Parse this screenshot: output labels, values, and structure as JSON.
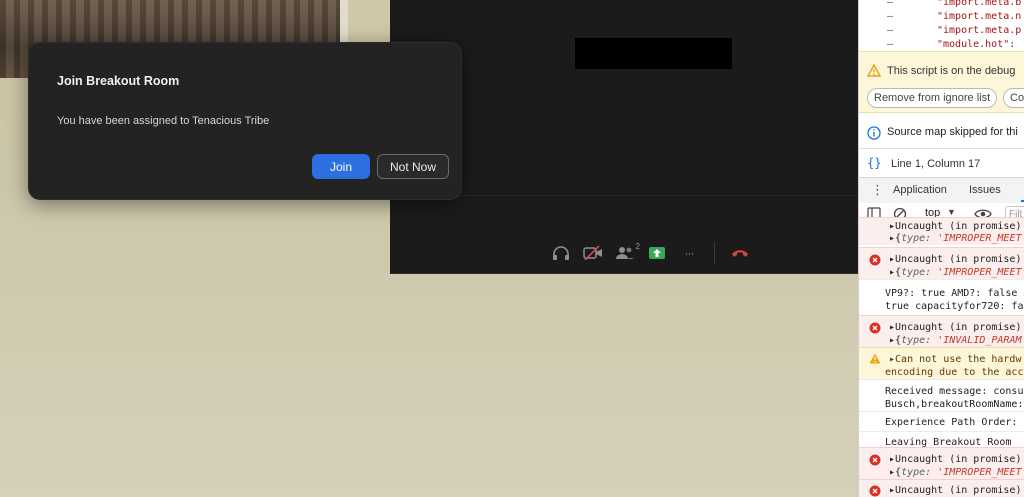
{
  "dialog": {
    "title": "Join Breakout Room",
    "message": "You have been assigned to Tenacious Tribe",
    "join_label": "Join",
    "not_now_label": "Not Now"
  },
  "zoom_toolbar": {
    "participants_count": "2",
    "more_label": "···"
  },
  "devtools": {
    "code_lines": [
      {
        "minus": "–",
        "text": "\"import.meta.b"
      },
      {
        "minus": "–",
        "text": "\"import.meta.n"
      },
      {
        "minus": "–",
        "text": "\"import.meta.p"
      },
      {
        "minus": "–",
        "text": "\"module.hot\": "
      }
    ],
    "warning_text": "This script is on the debug",
    "remove_ignore_label": "Remove from ignore list",
    "config_label": "Con",
    "source_map_text": "Source map skipped for thi",
    "position_text": "Line 1, Column 17",
    "tabs": [
      "Application",
      "Issues"
    ],
    "context_selector": "top",
    "filter_placeholder": "Filt",
    "messages": [
      {
        "kind": "error",
        "line1": "Uncaught (in promise)",
        "key": "type:",
        "value": "'IMPROPER_MEET"
      },
      {
        "kind": "error",
        "line1": "Uncaught (in promise)",
        "key": "type:",
        "value": "'IMPROPER_MEET"
      },
      {
        "kind": "info",
        "line1": "VP9?: true AMD?: false A",
        "line2": "true capacityfor720: fa"
      },
      {
        "kind": "error",
        "line1": "Uncaught (in promise)",
        "key": "type:",
        "value": "'INVALID_PARAM"
      },
      {
        "kind": "warn",
        "line1": "Can not use the hardw",
        "line2": "encoding due to the acc"
      },
      {
        "kind": "info",
        "line1": "Received message: consu",
        "line2": "Busch,breakoutRoomName:"
      },
      {
        "kind": "info",
        "line1": "Experience Path Order: 1"
      },
      {
        "kind": "info",
        "line1": "Leaving Breakout Room"
      },
      {
        "kind": "error",
        "line1": "Uncaught (in promise)",
        "key": "type:",
        "value": "'IMPROPER_MEET"
      },
      {
        "kind": "error",
        "line1": "Uncaught (in promise)"
      }
    ]
  },
  "colors": {
    "join_blue": "#2d6fe0",
    "dialog_bg": "#232323",
    "error_bg": "#fdeeee",
    "warn_bg": "#fdf6d8"
  }
}
